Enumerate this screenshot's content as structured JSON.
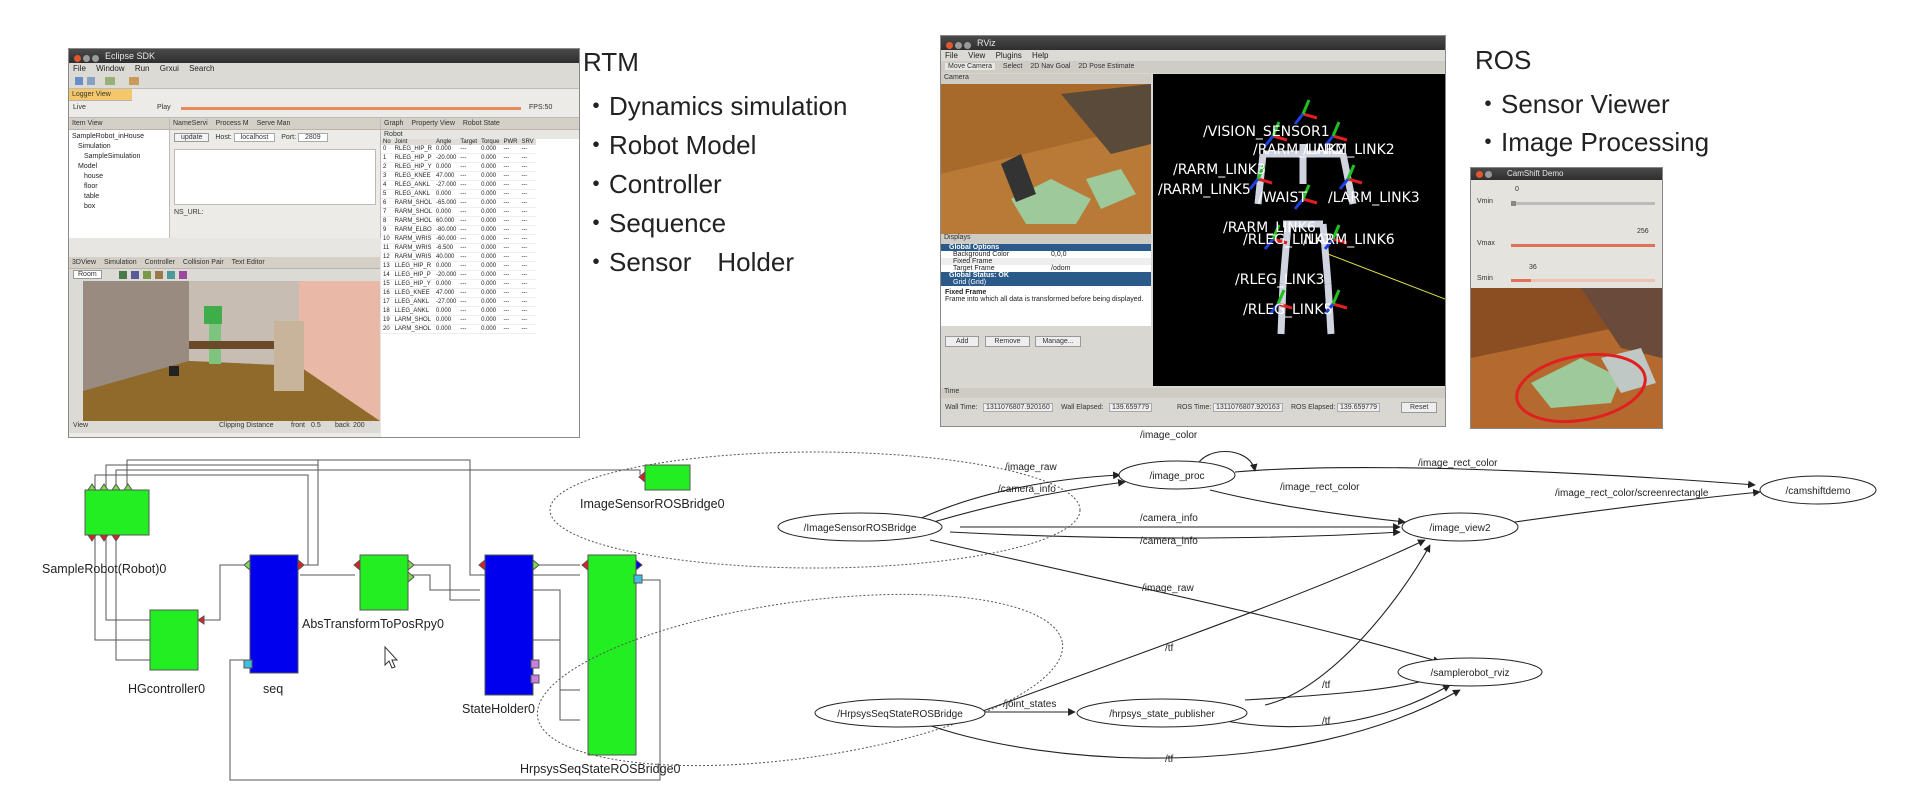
{
  "eclipse": {
    "title": "Eclipse SDK",
    "menu": [
      "File",
      "Window",
      "Run",
      "Grxui",
      "Search"
    ],
    "logger_tab": "Logger View",
    "logger_live": "Live",
    "logger_play": "Play",
    "logger_fps": "FPS:50",
    "item_view_tab": "Item View",
    "tree": [
      "SampleRobot_inHouse",
      "Simulation",
      "SampleSimulation",
      "Model",
      "house",
      "floor",
      "table",
      "box"
    ],
    "name_server_tab": "NameServi",
    "process_tab": "Process M",
    "serve_tab": "Serve Man",
    "update_label": "update",
    "host_label": "Host:",
    "host_value": "localhost",
    "port_label": "Port:",
    "port_value": "2809",
    "ns_url": "NS_URL:",
    "graph_tab": "Graph",
    "property_tab": "Property View",
    "robot_state_tab": "Robot State",
    "robot_label": "Robot",
    "columns": [
      "No",
      "Joint",
      "Angle",
      "Target",
      "Torque",
      "PWR",
      "SRV"
    ],
    "rows": [
      [
        "0",
        "RLEG_HIP_R",
        "0.000",
        "---",
        "0.000",
        "---",
        "---"
      ],
      [
        "1",
        "RLEG_HIP_P",
        "-20.000",
        "---",
        "0.000",
        "---",
        "---"
      ],
      [
        "2",
        "RLEG_HIP_Y",
        "0.000",
        "---",
        "0.000",
        "---",
        "---"
      ],
      [
        "3",
        "RLEG_KNEE",
        "47.000",
        "---",
        "0.000",
        "---",
        "---"
      ],
      [
        "4",
        "RLEG_ANKL",
        "-27.000",
        "---",
        "0.000",
        "---",
        "---"
      ],
      [
        "5",
        "RLEG_ANKL",
        "0.000",
        "---",
        "0.000",
        "---",
        "---"
      ],
      [
        "6",
        "RARM_SHOL",
        "-65.000",
        "---",
        "0.000",
        "---",
        "---"
      ],
      [
        "7",
        "RARM_SHOL",
        "0.000",
        "---",
        "0.000",
        "---",
        "---"
      ],
      [
        "8",
        "RARM_SHOL",
        "60.000",
        "---",
        "0.000",
        "---",
        "---"
      ],
      [
        "9",
        "RARM_ELBO",
        "-80.000",
        "---",
        "0.000",
        "---",
        "---"
      ],
      [
        "10",
        "RARM_WRIS",
        "-60.000",
        "---",
        "0.000",
        "---",
        "---"
      ],
      [
        "11",
        "RARM_WRIS",
        "-6.500",
        "---",
        "0.000",
        "---",
        "---"
      ],
      [
        "12",
        "RARM_WRIS",
        "40.000",
        "---",
        "0.000",
        "---",
        "---"
      ],
      [
        "13",
        "LLEG_HIP_R",
        "0.000",
        "---",
        "0.000",
        "---",
        "---"
      ],
      [
        "14",
        "LLEG_HIP_P",
        "-20.000",
        "---",
        "0.000",
        "---",
        "---"
      ],
      [
        "15",
        "LLEG_HIP_Y",
        "0.000",
        "---",
        "0.000",
        "---",
        "---"
      ],
      [
        "16",
        "LLEG_KNEE",
        "47.000",
        "---",
        "0.000",
        "---",
        "---"
      ],
      [
        "17",
        "LLEG_ANKL",
        "-27.000",
        "---",
        "0.000",
        "---",
        "---"
      ],
      [
        "18",
        "LLEG_ANKL",
        "0.000",
        "---",
        "0.000",
        "---",
        "---"
      ],
      [
        "19",
        "LARM_SHOL",
        "0.000",
        "---",
        "0.000",
        "---",
        "---"
      ],
      [
        "20",
        "LARM_SHOL",
        "0.000",
        "---",
        "0.000",
        "---",
        "---"
      ]
    ],
    "view_tabs": [
      "3DView",
      "Simulation",
      "Controller",
      "Collision Pair",
      "Text Editor"
    ],
    "view_mode": "Room",
    "status": "View",
    "clipping": "Clipping Distance",
    "front_label": "front",
    "front_value": "0.5",
    "back_label": "back",
    "back_value": "200"
  },
  "rtm": {
    "title": "RTM",
    "bullets": [
      "・Dynamics simulation",
      "・Robot Model",
      "・Controller",
      "・Sequence",
      "・Sensor　Holder"
    ]
  },
  "rviz": {
    "title": "RViz",
    "menu": [
      "File",
      "View",
      "Plugins",
      "Help"
    ],
    "tools": [
      "Move Camera",
      "Select",
      "2D Nav Goal",
      "2D Pose Estimate"
    ],
    "camera_label": "Camera",
    "displays_label": "Displays",
    "global_options": "Global Options",
    "background_color": "Background Color",
    "background_value": "0,0,0",
    "fixed_frame": "Fixed Frame",
    "target_frame": "Target Frame",
    "target_value": "/odom",
    "global_status": "Global Status: OK",
    "grid": "Grid (Grid)",
    "desc_title": "Fixed Frame",
    "desc_text": "Frame into which all data is transformed before being displayed.",
    "buttons": [
      "Add",
      "Remove",
      "Manage..."
    ],
    "time_label": "Time",
    "wall_time": "Wall Time:",
    "wall_time_value": "1311076807.920160",
    "wall_elapsed": "Wall Elapsed:",
    "wall_elapsed_value": "139.659779",
    "ros_time": "ROS Time:",
    "ros_time_value": "1311076807.920163",
    "ros_elapsed": "ROS Elapsed:",
    "ros_elapsed_value": "139.659779",
    "reset": "Reset",
    "frames": [
      "/VISION_SENSOR1",
      "/RARM_LINK2",
      "/LARM_LINK2",
      "/RARM_LINK3",
      "/RARM_LINK5",
      "/WAIST",
      "/LARM_LINK3",
      "/RARM_LINK6",
      "/RLEG_LINK2",
      "/LARM_LINK6",
      "/RLEG_LINK3",
      "/RLEG_LINK5"
    ]
  },
  "ros": {
    "title": "ROS",
    "bullets": [
      "・Sensor Viewer",
      "・Image Processing"
    ]
  },
  "camshift": {
    "title": "CamShift Demo",
    "vmin_label": "Vmin",
    "vmin_value": "0",
    "vmax_label": "Vmax",
    "vmax_value": "256",
    "smin_label": "Smin",
    "smin_value": "36",
    "vmin_level": 0.0,
    "vmax_level": 1.0,
    "smin_level": 0.14
  },
  "rtm_diagram": {
    "components": [
      "SampleRobot(Robot)0",
      "HGcontroller0",
      "seq",
      "AbsTransformToPosRpy0",
      "StateHolder0",
      "HrpsysSeqStateROSBridge0",
      "ImageSensorROSBridge0"
    ]
  },
  "ros_graph": {
    "nodes": [
      "/ImageSensorROSBridge",
      "/image_proc",
      "/image_view2",
      "/camshiftdemo",
      "/HrpsysSeqStateROSBridge",
      "/hrpsys_state_publisher",
      "/samplerobot_rviz"
    ],
    "edges": [
      "/image_color",
      "/image_raw",
      "/camera_info",
      "/image_rect_color",
      "/image_rect_color",
      "/image_rect_color/screenrectangle",
      "/camera_info",
      "/camera_info",
      "/image_raw",
      "/tf",
      "/joint_states",
      "/tf",
      "/tf",
      "/tf"
    ]
  },
  "colors": {
    "component_green": "#22ee22",
    "component_blue": "#0000ee",
    "port_red": "#e02020",
    "port_cyan": "#40c0e0"
  }
}
